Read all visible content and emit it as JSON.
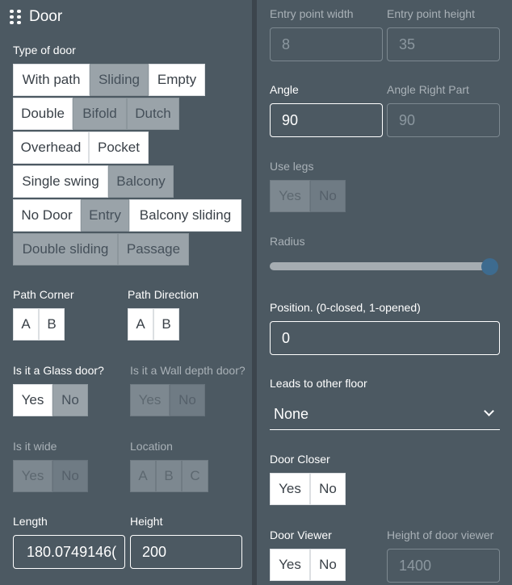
{
  "left": {
    "title": "Door",
    "type_label": "Type of door",
    "door_types": [
      {
        "label": "With path",
        "state": "on"
      },
      {
        "label": "Sliding",
        "state": "off"
      },
      {
        "label": "Empty",
        "state": "on"
      },
      {
        "label": "Double",
        "state": "on"
      },
      {
        "label": "Bifold",
        "state": "off"
      },
      {
        "label": "Dutch",
        "state": "off"
      },
      {
        "label": "Overhead",
        "state": "on"
      },
      {
        "label": "Pocket",
        "state": "on"
      },
      {
        "label": "Single swing",
        "state": "on"
      },
      {
        "label": "Balcony",
        "state": "off"
      },
      {
        "label": "No Door",
        "state": "on"
      },
      {
        "label": "Entry",
        "state": "off"
      },
      {
        "label": "Balcony sliding",
        "state": "on"
      },
      {
        "label": "Double sliding",
        "state": "off"
      },
      {
        "label": "Passage",
        "state": "off"
      }
    ],
    "path_corner": {
      "label": "Path Corner",
      "options": [
        "A",
        "B"
      ]
    },
    "path_direction": {
      "label": "Path Direction",
      "options": [
        "A",
        "B"
      ]
    },
    "glass_door": {
      "label": "Is it a Glass door?",
      "yes": "Yes",
      "no": "No"
    },
    "wall_depth": {
      "label": "Is it a Wall depth door?",
      "yes": "Yes",
      "no": "No"
    },
    "is_wide": {
      "label": "Is it wide",
      "yes": "Yes",
      "no": "No"
    },
    "location": {
      "label": "Location",
      "options": [
        "A",
        "B",
        "C"
      ]
    },
    "length": {
      "label": "Length",
      "value": "180.0749146("
    },
    "height": {
      "label": "Height",
      "value": "200"
    }
  },
  "right": {
    "entry_width": {
      "label": "Entry point width",
      "value": "8"
    },
    "entry_height": {
      "label": "Entry point height",
      "value": "35"
    },
    "angle": {
      "label": "Angle",
      "value": "90"
    },
    "angle_right": {
      "label": "Angle Right Part",
      "value": "90"
    },
    "use_legs": {
      "label": "Use legs",
      "yes": "Yes",
      "no": "No"
    },
    "radius": {
      "label": "Radius",
      "level": 1.0
    },
    "position": {
      "label": "Position. (0-closed, 1-opened)",
      "value": "0"
    },
    "leads_to": {
      "label": "Leads to other floor",
      "value": "None"
    },
    "door_closer": {
      "label": "Door Closer",
      "yes": "Yes",
      "no": "No"
    },
    "door_viewer": {
      "label": "Door Viewer",
      "yes": "Yes",
      "no": "No"
    },
    "viewer_height": {
      "label": "Height of door viewer",
      "value": "1400"
    }
  }
}
